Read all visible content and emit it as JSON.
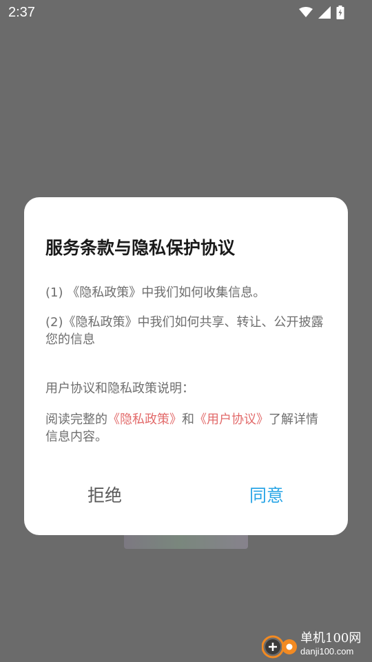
{
  "status_bar": {
    "time": "2:37",
    "icons": [
      "wifi-icon",
      "signal-icon",
      "battery-charging-icon"
    ]
  },
  "dialog": {
    "title": "服务条款与隐私保护协议",
    "items": [
      "(1) 《隐私政策》中我们如何收集信息。",
      "(2)《隐私政策》中我们如何共享、转让、公开披露您的信息"
    ],
    "section_label": "用户协议和隐私政策说明：",
    "read_prefix": "阅读完整的",
    "privacy_link": "《隐私政策》",
    "and_text": "和",
    "user_agreement_link": "《用户协议》",
    "read_suffix": "了解详情信息内容。",
    "reject_label": "拒绝",
    "agree_label": "同意",
    "colors": {
      "link": "#e26a6a",
      "agree": "#29a5e6",
      "reject": "#5a5a5a"
    }
  },
  "watermark": {
    "line1": "单机100网",
    "line2": "danji100.com"
  }
}
